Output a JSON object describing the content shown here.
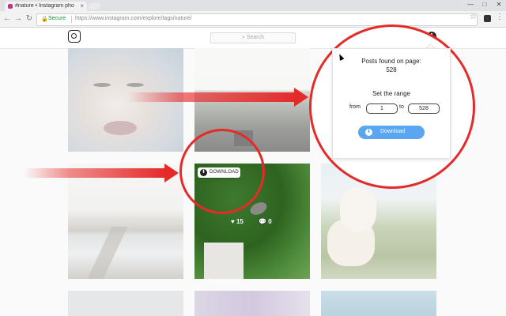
{
  "browser": {
    "tab_title": "#nature • Instagram pho",
    "tab_close": "×",
    "secure_label": "Secure",
    "url": "https://www.instagram.com/explore/tags/nature/",
    "window_minimize": "—",
    "window_maximize": "□",
    "window_close": "✕"
  },
  "instagram": {
    "search_placeholder": "Search"
  },
  "popup": {
    "posts_found_label": "Posts found on page:",
    "posts_found_count": "528",
    "range_title": "Set the range",
    "from_label": "from",
    "from_value": "1",
    "to_label": "to",
    "to_value": "528",
    "download_button": "Download"
  },
  "post_overlay": {
    "download_badge": "DOWNLOAD",
    "likes": "15",
    "comments": "0"
  },
  "colors": {
    "accent_red": "#e52a2a",
    "download_blue": "#5ba6ee"
  }
}
